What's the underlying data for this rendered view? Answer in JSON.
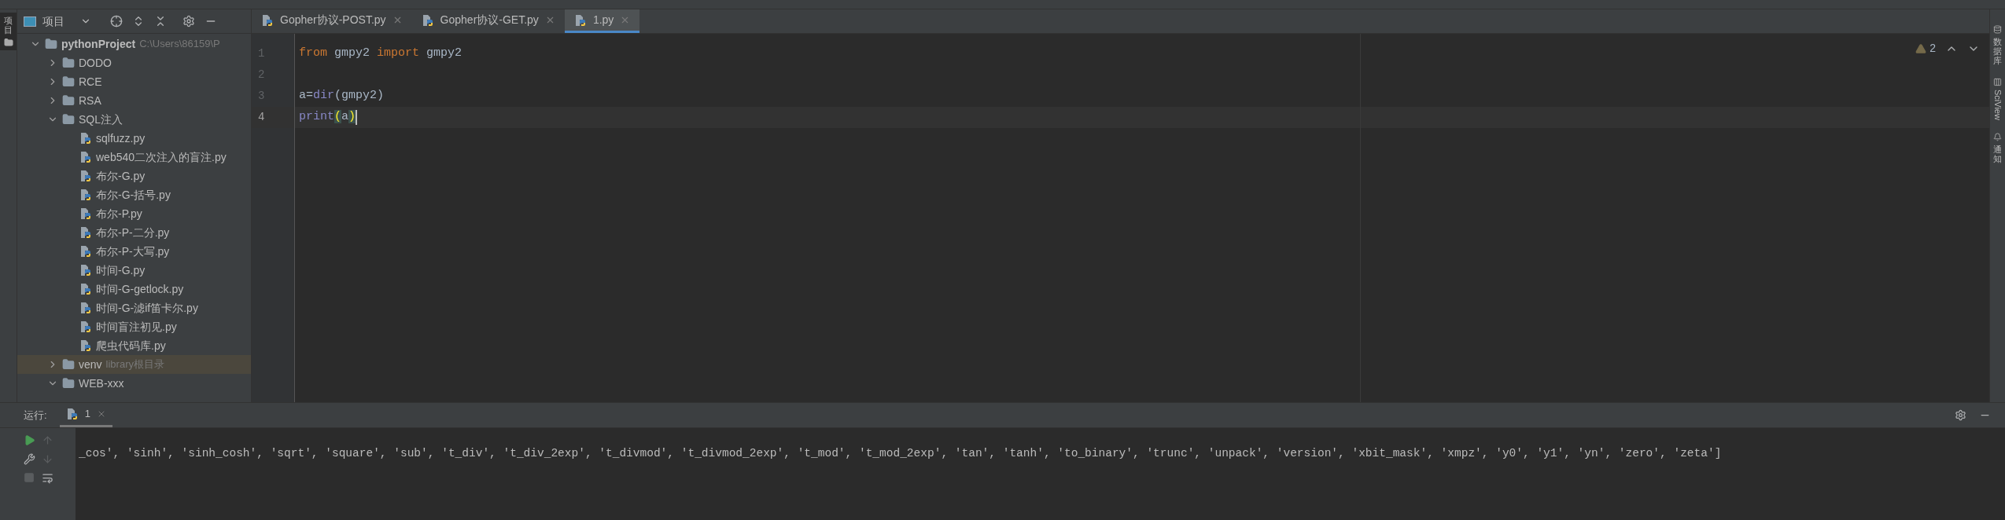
{
  "left_stripe": {
    "label": "项目"
  },
  "project_panel": {
    "title": "项目",
    "tree": [
      {
        "name": "pythonProject",
        "hint": "C:\\Users\\86159\\P",
        "kind": "folder",
        "expanded": true,
        "selected": false,
        "children": [
          {
            "name": "DODO",
            "kind": "folder",
            "expanded": false,
            "selected": false
          },
          {
            "name": "RCE",
            "kind": "folder",
            "expanded": false,
            "selected": false
          },
          {
            "name": "RSA",
            "kind": "folder",
            "expanded": false,
            "selected": false
          },
          {
            "name": "SQL注入",
            "kind": "folder",
            "expanded": true,
            "selected": false,
            "children": [
              {
                "name": "sqlfuzz.py",
                "kind": "python",
                "selected": false
              },
              {
                "name": "web540二次注入的盲注.py",
                "kind": "python",
                "selected": false
              },
              {
                "name": "布尔-G.py",
                "kind": "python",
                "selected": false
              },
              {
                "name": "布尔-G-括号.py",
                "kind": "python",
                "selected": false
              },
              {
                "name": "布尔-P.py",
                "kind": "python",
                "selected": false
              },
              {
                "name": "布尔-P-二分.py",
                "kind": "python",
                "selected": false
              },
              {
                "name": "布尔-P-大写.py",
                "kind": "python",
                "selected": false
              },
              {
                "name": "时间-G.py",
                "kind": "python",
                "selected": false
              },
              {
                "name": "时间-G-getlock.py",
                "kind": "python",
                "selected": false
              },
              {
                "name": "时间-G-滤if笛卡尔.py",
                "kind": "python",
                "selected": false
              },
              {
                "name": "时间盲注初见.py",
                "kind": "python",
                "selected": false
              },
              {
                "name": "爬虫代码库.py",
                "kind": "python",
                "selected": false
              }
            ]
          },
          {
            "name": "venv",
            "hint": "library根目录",
            "kind": "folder",
            "expanded": false,
            "selected": true
          },
          {
            "name": "WEB-xxx",
            "kind": "folder",
            "expanded": true,
            "selected": false
          }
        ]
      }
    ]
  },
  "editor": {
    "tabs": [
      {
        "label": "Gopher协议-POST.py",
        "selected": false
      },
      {
        "label": "Gopher协议-GET.py",
        "selected": false
      },
      {
        "label": "1.py",
        "selected": true
      }
    ],
    "warnings": "2",
    "lines": [
      {
        "number": "1",
        "current": false,
        "tokens": [
          {
            "text": "from",
            "kind": "keyword"
          },
          {
            "text": " gmpy2 ",
            "kind": "plain"
          },
          {
            "text": "import",
            "kind": "keyword"
          },
          {
            "text": " gmpy2",
            "kind": "plain"
          }
        ]
      },
      {
        "number": "2",
        "current": false
      },
      {
        "number": "3",
        "current": false,
        "tokens": [
          {
            "text": "a",
            "kind": "plain"
          },
          {
            "text": "=",
            "kind": "plain"
          },
          {
            "text": "dir",
            "kind": "builtin"
          },
          {
            "text": "(gmpy2)",
            "kind": "plain"
          }
        ]
      },
      {
        "number": "4",
        "current": true,
        "tokens": [
          {
            "text": "print",
            "kind": "builtin"
          },
          {
            "text": "(",
            "kind": "brace"
          },
          {
            "text": "a",
            "kind": "plain"
          },
          {
            "text": ")",
            "kind": "brace"
          }
        ]
      }
    ]
  },
  "right_stripe": [
    {
      "label": "数据库",
      "kind": "cjk"
    },
    {
      "label": "SciView",
      "kind": "latin"
    },
    {
      "label": "通知",
      "kind": "cjk"
    }
  ],
  "run_panel": {
    "label": "运行:",
    "tabs": [
      {
        "label": "1",
        "selected": true
      }
    ],
    "output": "_cos', 'sinh', 'sinh_cosh', 'sqrt', 'square', 'sub', 't_div', 't_div_2exp', 't_divmod', 't_divmod_2exp', 't_mod', 't_mod_2exp', 'tan', 'tanh', 'to_binary', 'trunc', 'unpack', 'version', 'xbit_mask', 'xmpz', 'y0', 'y1', 'yn', 'zero', 'zeta']"
  }
}
